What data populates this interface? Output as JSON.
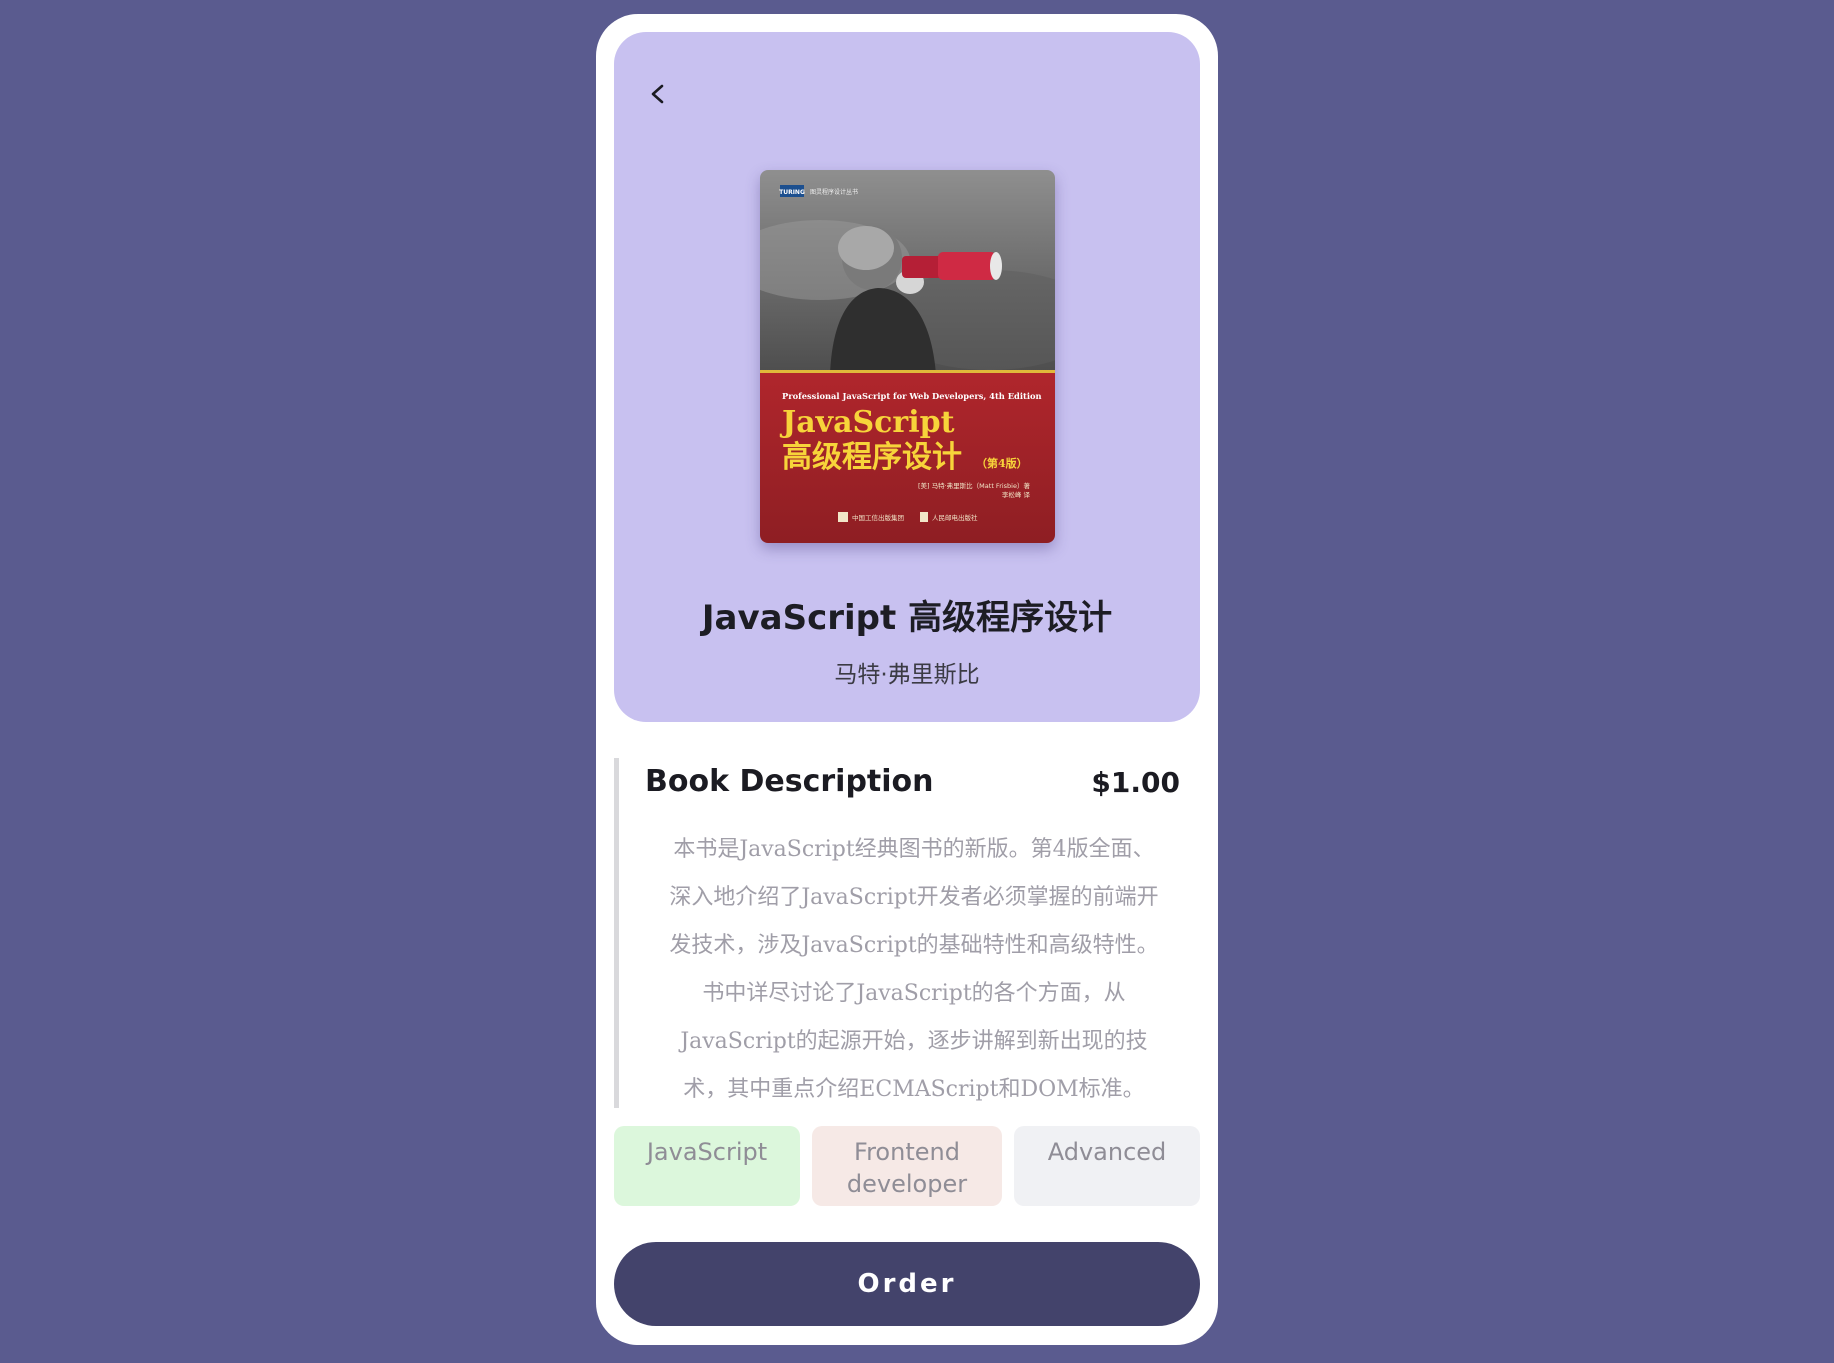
{
  "hero": {
    "back_icon": "chevron-left-icon",
    "cover": {
      "series_badge": "TURING",
      "series_name": "图灵程序设计丛书",
      "subtitle_en": "Professional JavaScript for Web Developers, 4th Edition",
      "title_en": "JavaScript",
      "title_cn": "高级程序设计",
      "edition": "（第4版）",
      "author_line": "[美] 马特·弗里斯比（Matt Frisbie）著",
      "translator_line": "李松峰 译",
      "publisher_1": "中国工信出版集团",
      "publisher_2": "人民邮电出版社"
    },
    "title": "JavaScript 高级程序设计",
    "author": "马特·弗里斯比"
  },
  "description": {
    "heading": "Book Description",
    "price": "$1.00",
    "lines": [
      "本书是JavaScript经典图书的新版。第4版全面、",
      "深入地介绍了JavaScript开发者必须掌握的前端开",
      "发技术，涉及JavaScript的基础特性和高级特性。",
      "书中详尽讨论了JavaScript的各个方面，从",
      "JavaScript的起源开始，逐步讲解到新出现的技",
      "术，其中重点介绍ECMAScript和DOM标准。"
    ]
  },
  "tags": [
    {
      "label": "JavaScript",
      "color": "#dcf7dc"
    },
    {
      "label": "Frontend developer",
      "color": "#f6e9e6"
    },
    {
      "label": "Advanced",
      "color": "#f0f1f4"
    }
  ],
  "order": {
    "label": "Order"
  },
  "colors": {
    "background": "#5a5b8f",
    "hero": "#c8c1f0",
    "button": "#43436b",
    "cover_red": "#a3242a",
    "cover_yellow": "#f7d43a"
  }
}
